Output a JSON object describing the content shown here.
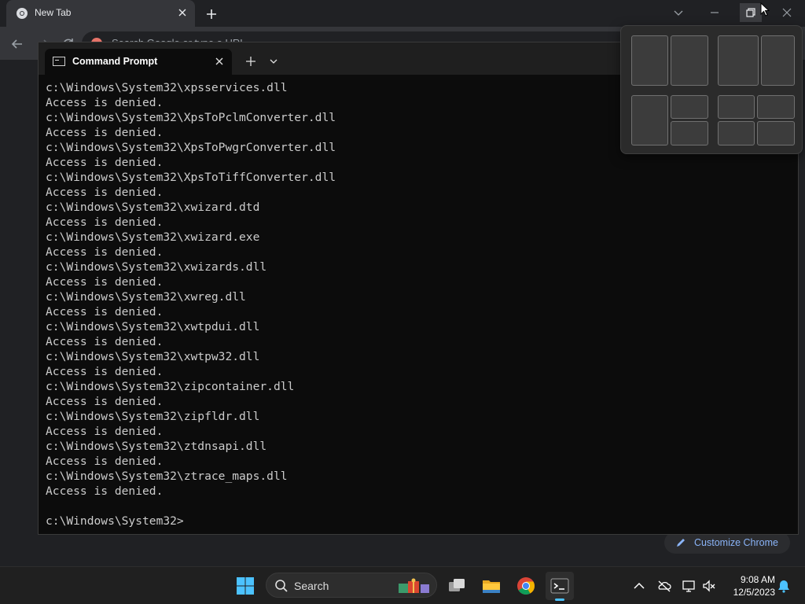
{
  "chrome": {
    "tab_title": "New Tab",
    "omnibox_placeholder": "Search Google or type a URL",
    "customize_label": "Customize Chrome"
  },
  "terminal": {
    "tab_title": "Command Prompt",
    "lines": [
      "c:\\Windows\\System32\\xpsservices.dll",
      "Access is denied.",
      "c:\\Windows\\System32\\XpsToPclmConverter.dll",
      "Access is denied.",
      "c:\\Windows\\System32\\XpsToPwgrConverter.dll",
      "Access is denied.",
      "c:\\Windows\\System32\\XpsToTiffConverter.dll",
      "Access is denied.",
      "c:\\Windows\\System32\\xwizard.dtd",
      "Access is denied.",
      "c:\\Windows\\System32\\xwizard.exe",
      "Access is denied.",
      "c:\\Windows\\System32\\xwizards.dll",
      "Access is denied.",
      "c:\\Windows\\System32\\xwreg.dll",
      "Access is denied.",
      "c:\\Windows\\System32\\xwtpdui.dll",
      "Access is denied.",
      "c:\\Windows\\System32\\xwtpw32.dll",
      "Access is denied.",
      "c:\\Windows\\System32\\zipcontainer.dll",
      "Access is denied.",
      "c:\\Windows\\System32\\zipfldr.dll",
      "Access is denied.",
      "c:\\Windows\\System32\\ztdnsapi.dll",
      "Access is denied.",
      "c:\\Windows\\System32\\ztrace_maps.dll",
      "Access is denied.",
      "",
      "c:\\Windows\\System32>"
    ]
  },
  "taskbar": {
    "search_label": "Search",
    "time": "9:08 AM",
    "date": "12/5/2023"
  },
  "icons": {
    "start": "windows-start-icon",
    "search": "search-icon",
    "task_view": "task-view-icon",
    "explorer": "file-explorer-icon",
    "chrome": "chrome-icon",
    "terminal": "terminal-icon",
    "tray": [
      "chevron-up-icon",
      "onedrive-icon",
      "network-icon",
      "volume-muted-icon",
      "notification-bell-icon"
    ]
  },
  "colors": {
    "terminal_bg": "#0c0c0c",
    "terminal_fg": "#cccccc",
    "accent": "#4cc2ff",
    "chrome_link": "#8ab4f8"
  }
}
